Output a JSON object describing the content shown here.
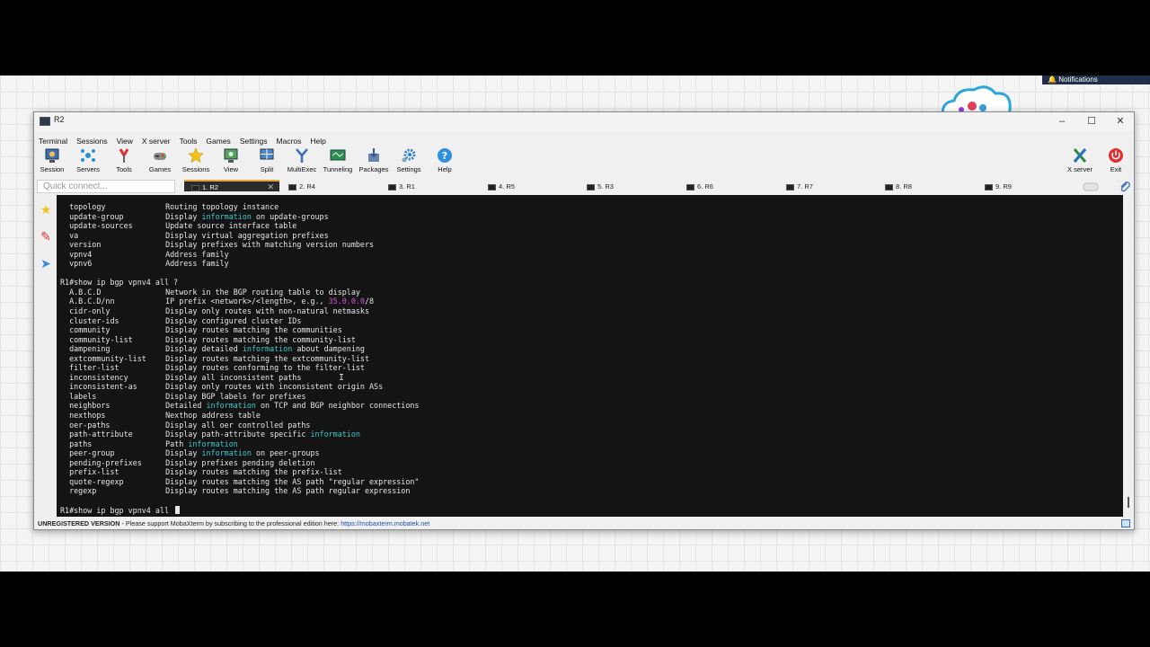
{
  "notification": {
    "label": "Notifications"
  },
  "window": {
    "title": "R2"
  },
  "menu": [
    "Terminal",
    "Sessions",
    "View",
    "X server",
    "Tools",
    "Games",
    "Settings",
    "Macros",
    "Help"
  ],
  "toolbar": {
    "buttons": [
      {
        "label": "Session",
        "icon": "session-icon"
      },
      {
        "label": "Servers",
        "icon": "servers-icon"
      },
      {
        "label": "Tools",
        "icon": "tools-icon"
      },
      {
        "label": "Games",
        "icon": "games-icon"
      },
      {
        "label": "Sessions",
        "icon": "star-icon"
      },
      {
        "label": "View",
        "icon": "view-icon"
      },
      {
        "label": "Split",
        "icon": "split-icon"
      },
      {
        "label": "MultiExec",
        "icon": "multiexec-icon"
      },
      {
        "label": "Tunneling",
        "icon": "tunneling-icon"
      },
      {
        "label": "Packages",
        "icon": "packages-icon"
      },
      {
        "label": "Settings",
        "icon": "gear-icon"
      },
      {
        "label": "Help",
        "icon": "help-icon"
      }
    ],
    "xserver_label": "X server",
    "exit_label": "Exit"
  },
  "quick_connect": {
    "placeholder": "Quick connect..."
  },
  "tabs": [
    "1. R2",
    "2. R4",
    "3. R1",
    "4. R5",
    "5. R3",
    "6. R6",
    "7. R7",
    "8. R8",
    "9. R9"
  ],
  "terminal": {
    "top_rows": [
      {
        "cmd": "topology",
        "desc": [
          "Routing topology instance"
        ]
      },
      {
        "cmd": "update-group",
        "desc": [
          "Display ",
          "information",
          " on update-groups"
        ]
      },
      {
        "cmd": "update-sources",
        "desc": [
          "Update source interface table"
        ]
      },
      {
        "cmd": "va",
        "desc": [
          "Display virtual aggregation prefixes"
        ]
      },
      {
        "cmd": "version",
        "desc": [
          "Display prefixes with matching version numbers"
        ]
      },
      {
        "cmd": "vpnv4",
        "desc": [
          "Address family"
        ]
      },
      {
        "cmd": "vpnv6",
        "desc": [
          "Address family"
        ]
      }
    ],
    "prompt1": "R1#show ip bgp vpnv4 all ?",
    "rows": [
      {
        "cmd": "A.B.C.D",
        "desc": [
          "Network in the BGP routing table to display"
        ]
      },
      {
        "cmd": "A.B.C.D/nn",
        "desc": [
          "IP prefix <network>/<length>, e.g., ",
          "35.0.0.0",
          "/8"
        ]
      },
      {
        "cmd": "cidr-only",
        "desc": [
          "Display only routes with non-natural netmasks"
        ]
      },
      {
        "cmd": "cluster-ids",
        "desc": [
          "Display configured cluster IDs"
        ]
      },
      {
        "cmd": "community",
        "desc": [
          "Display routes matching the communities"
        ]
      },
      {
        "cmd": "community-list",
        "desc": [
          "Display routes matching the community-list"
        ]
      },
      {
        "cmd": "dampening",
        "desc": [
          "Display detailed ",
          "information",
          " about dampening"
        ]
      },
      {
        "cmd": "extcommunity-list",
        "desc": [
          "Display routes matching the extcommunity-list"
        ]
      },
      {
        "cmd": "filter-list",
        "desc": [
          "Display routes conforming to the filter-list"
        ]
      },
      {
        "cmd": "inconsistency",
        "desc": [
          "Display all inconsistent paths"
        ]
      },
      {
        "cmd": "inconsistent-as",
        "desc": [
          "Display only routes with inconsistent origin ASs"
        ]
      },
      {
        "cmd": "labels",
        "desc": [
          "Display BGP labels for prefixes"
        ]
      },
      {
        "cmd": "neighbors",
        "desc": [
          "Detailed ",
          "information",
          " on TCP and BGP neighbor connections"
        ]
      },
      {
        "cmd": "nexthops",
        "desc": [
          "Nexthop address table"
        ]
      },
      {
        "cmd": "oer-paths",
        "desc": [
          "Display all oer controlled paths"
        ]
      },
      {
        "cmd": "path-attribute",
        "desc": [
          "Display path-attribute specific ",
          "information"
        ]
      },
      {
        "cmd": "paths",
        "desc": [
          "Path ",
          "information"
        ]
      },
      {
        "cmd": "peer-group",
        "desc": [
          "Display ",
          "information",
          " on peer-groups"
        ]
      },
      {
        "cmd": "pending-prefixes",
        "desc": [
          "Display prefixes pending deletion"
        ]
      },
      {
        "cmd": "prefix-list",
        "desc": [
          "Display routes matching the prefix-list"
        ]
      },
      {
        "cmd": "quote-regexp",
        "desc": [
          "Display routes matching the AS path \"regular expression\""
        ]
      },
      {
        "cmd": "regexp",
        "desc": [
          "Display routes matching the AS path regular expression"
        ]
      }
    ],
    "prompt2": "R1#show ip bgp vpnv4 all "
  },
  "statusbar": {
    "unregistered": "UNREGISTERED VERSION",
    "message": " -  Please support MobaXterm by subscribing to the professional edition here: ",
    "link": "https://mobaxterm.mobatek.net"
  },
  "colors": {
    "terminal_bg": "#141414",
    "highlight_info": "#3ec9c9",
    "highlight_ip": "#d94fd9",
    "active_tab_accent": "#e8a23a"
  }
}
